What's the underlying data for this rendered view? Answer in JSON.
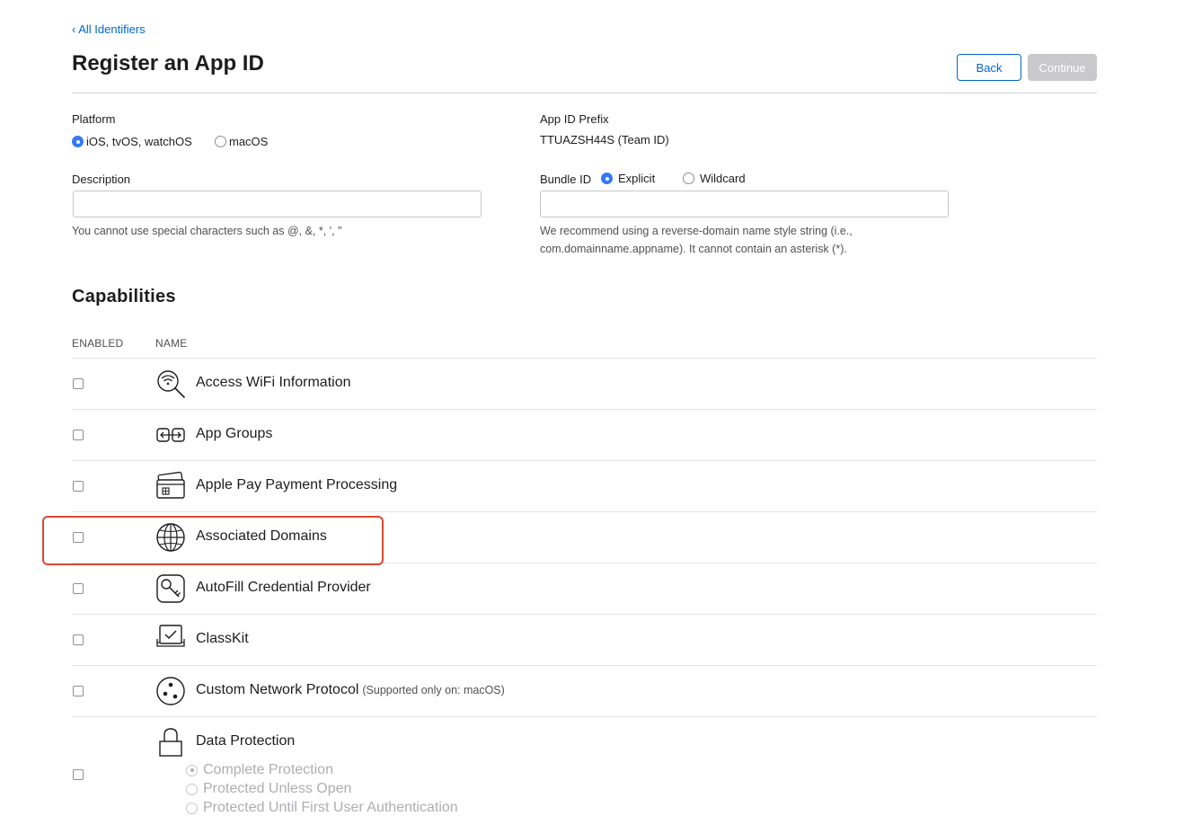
{
  "nav": {
    "back_link": "‹ All Identifiers"
  },
  "header": {
    "title": "Register an App ID",
    "back_label": "Back",
    "continue_label": "Continue"
  },
  "platform": {
    "label": "Platform",
    "options": [
      {
        "label": "iOS, tvOS, watchOS",
        "selected": true
      },
      {
        "label": "macOS",
        "selected": false
      }
    ]
  },
  "prefix": {
    "label": "App ID Prefix",
    "value": "TTUAZSH44S (Team ID)"
  },
  "description": {
    "label": "Description",
    "value": "",
    "hint": "You cannot use special characters such as @, &, *, ', \""
  },
  "bundle": {
    "label": "Bundle ID",
    "options": [
      {
        "label": "Explicit",
        "selected": true
      },
      {
        "label": "Wildcard",
        "selected": false
      }
    ],
    "value": "",
    "hint_line1": "We recommend using a reverse-domain name style string (i.e.,",
    "hint_line2": "com.domainname.appname). It cannot contain an asterisk (*)."
  },
  "capabilities": {
    "title": "Capabilities",
    "columns": [
      "ENABLED",
      "NAME"
    ],
    "items": [
      {
        "name": "Access WiFi Information",
        "note": "",
        "icon": "wifi-search-icon",
        "enabled": false
      },
      {
        "name": "App Groups",
        "note": "",
        "icon": "app-groups-icon",
        "enabled": false
      },
      {
        "name": "Apple Pay Payment Processing",
        "note": "",
        "icon": "payment-card-icon",
        "enabled": false
      },
      {
        "name": "Associated Domains",
        "note": "",
        "icon": "globe-icon",
        "enabled": false
      },
      {
        "name": "AutoFill Credential Provider",
        "note": "",
        "icon": "key-icon",
        "enabled": false
      },
      {
        "name": "ClassKit",
        "note": "",
        "icon": "classkit-icon",
        "enabled": false
      },
      {
        "name": "Custom Network Protocol",
        "note": "(Supported only on: macOS)",
        "icon": "network-protocol-icon",
        "enabled": false
      },
      {
        "name": "Data Protection",
        "note": "",
        "icon": "lock-icon",
        "enabled": false
      }
    ],
    "data_protection_options": [
      {
        "label": "Complete Protection",
        "selected": true
      },
      {
        "label": "Protected Unless Open",
        "selected": false
      },
      {
        "label": "Protected Until First User Authentication",
        "selected": false
      }
    ]
  },
  "colors": {
    "accent": "#0066cc",
    "radio_on": "#3478f6",
    "highlight": "#e0472f",
    "disabled_button": "#c9c9cc"
  }
}
